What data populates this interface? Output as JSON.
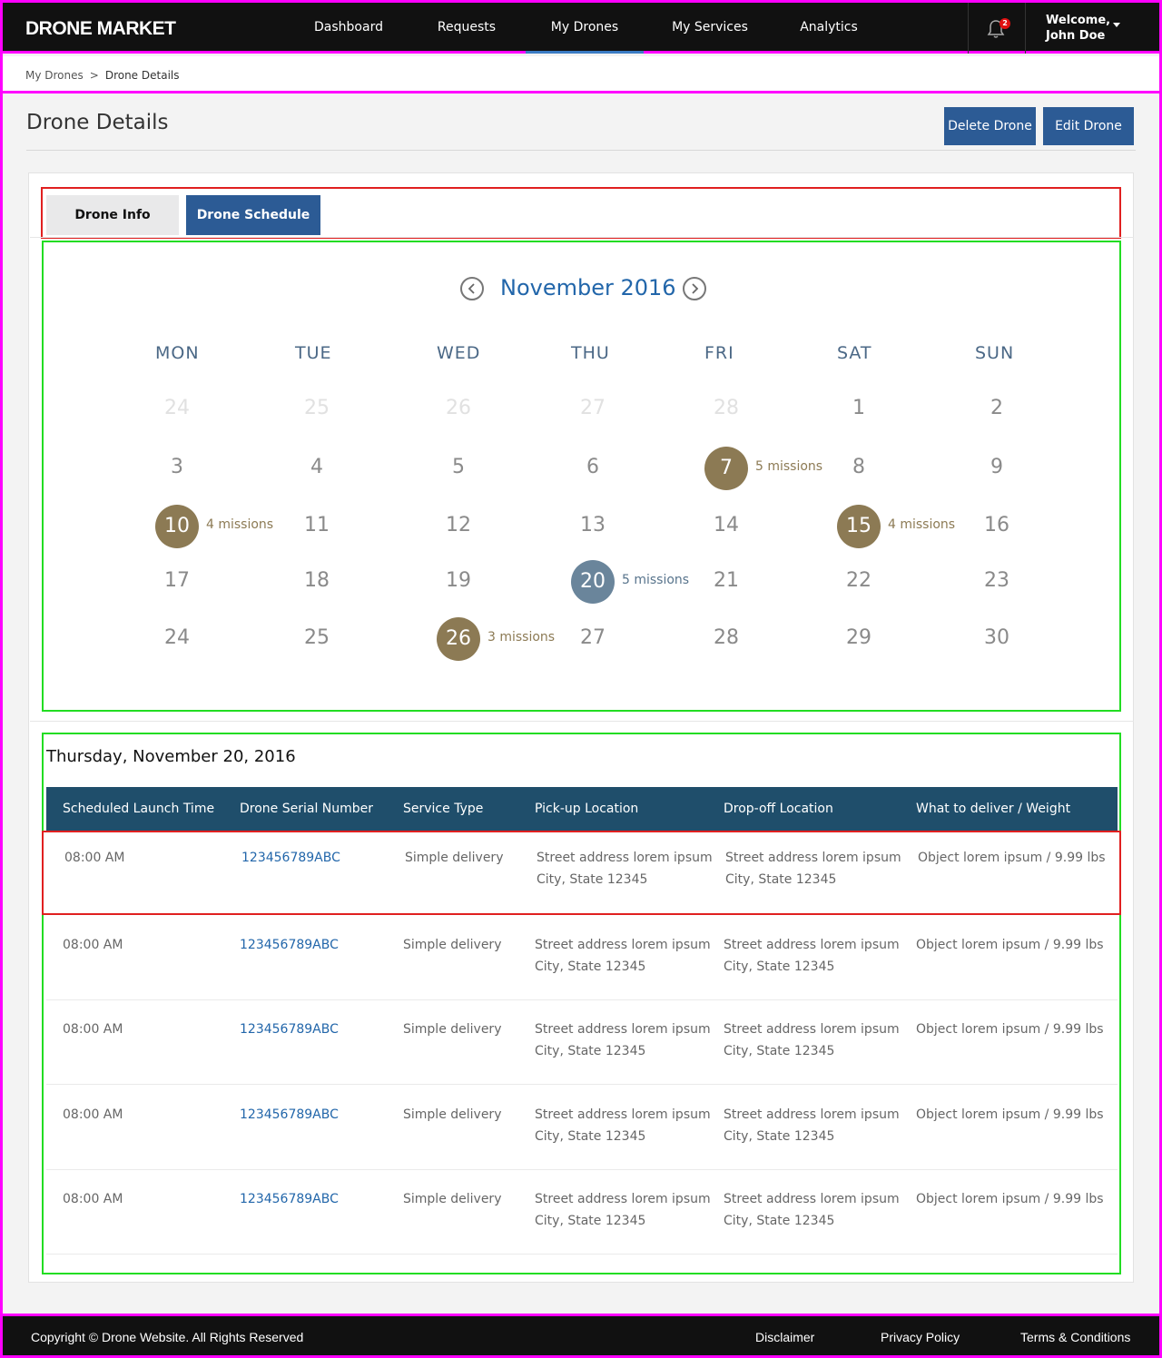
{
  "header": {
    "brand": "DRONE MARKET",
    "nav": [
      {
        "label": "Dashboard",
        "active": false
      },
      {
        "label": "Requests",
        "active": false
      },
      {
        "label": "My Drones",
        "active": true
      },
      {
        "label": "My Services",
        "active": false
      },
      {
        "label": "Analytics",
        "active": false
      }
    ],
    "notification_count": "2",
    "notification_icon": "bell-icon",
    "welcome_line1": "Welcome,",
    "welcome_line2": "John Doe",
    "user_menu_icon": "caret-down-icon"
  },
  "breadcrumb": {
    "items": [
      "My Drones",
      "Drone Details"
    ],
    "separator": ">"
  },
  "page": {
    "title": "Drone Details",
    "delete_label": "Delete Drone",
    "edit_label": "Edit Drone"
  },
  "tabs": [
    {
      "label": "Drone Info",
      "active": false
    },
    {
      "label": "Drone Schedule",
      "active": true
    }
  ],
  "calendar": {
    "month_label": "November 2016",
    "prev_icon": "chevron-left-icon",
    "next_icon": "chevron-right-icon",
    "weekdays": [
      "MON",
      "TUE",
      "WED",
      "THU",
      "FRI",
      "SAT",
      "SUN"
    ],
    "weeks": [
      [
        {
          "d": "24",
          "muted": true
        },
        {
          "d": "25",
          "muted": true
        },
        {
          "d": "26",
          "muted": true
        },
        {
          "d": "27",
          "muted": true
        },
        {
          "d": "28",
          "muted": true
        },
        {
          "d": "1"
        },
        {
          "d": "2"
        }
      ],
      [
        {
          "d": "3"
        },
        {
          "d": "4"
        },
        {
          "d": "5"
        },
        {
          "d": "6"
        },
        {
          "d": "7",
          "missions": "5 missions"
        },
        {
          "d": "8"
        },
        {
          "d": "9"
        }
      ],
      [
        {
          "d": "10",
          "missions": "4 missions"
        },
        {
          "d": "11"
        },
        {
          "d": "12"
        },
        {
          "d": "13"
        },
        {
          "d": "14"
        },
        {
          "d": "15",
          "missions": "4 missions"
        },
        {
          "d": "16"
        }
      ],
      [
        {
          "d": "17"
        },
        {
          "d": "18"
        },
        {
          "d": "19"
        },
        {
          "d": "20",
          "missions": "5 missions",
          "selected": true
        },
        {
          "d": "21"
        },
        {
          "d": "22"
        },
        {
          "d": "23"
        }
      ],
      [
        {
          "d": "24"
        },
        {
          "d": "25"
        },
        {
          "d": "26",
          "missions": "3 missions"
        },
        {
          "d": "27"
        },
        {
          "d": "28"
        },
        {
          "d": "29"
        },
        {
          "d": "30"
        }
      ]
    ],
    "colors": {
      "mission": "#8c7a54",
      "selected": "#6a859b"
    }
  },
  "schedule": {
    "date_label": "Thursday, November 20, 2016",
    "columns": [
      "Scheduled Launch Time",
      "Drone Serial Number",
      "Service Type",
      "Pick-up Location",
      "Drop-off Location",
      "What to deliver / Weight"
    ],
    "rows": [
      {
        "time": "08:00 AM",
        "serial": "123456789ABC",
        "service": "Simple delivery",
        "pickup1": "Street address lorem ipsum",
        "pickup2": "City, State 12345",
        "drop1": "Street address lorem ipsum",
        "drop2": "City, State 12345",
        "deliver": "Object lorem ipsum / 9.99 lbs"
      },
      {
        "time": "08:00 AM",
        "serial": "123456789ABC",
        "service": "Simple delivery",
        "pickup1": "Street address lorem ipsum",
        "pickup2": "City, State 12345",
        "drop1": "Street address lorem ipsum",
        "drop2": "City, State 12345",
        "deliver": "Object lorem ipsum / 9.99 lbs"
      },
      {
        "time": "08:00 AM",
        "serial": "123456789ABC",
        "service": "Simple delivery",
        "pickup1": "Street address lorem ipsum",
        "pickup2": "City, State 12345",
        "drop1": "Street address lorem ipsum",
        "drop2": "City, State 12345",
        "deliver": "Object lorem ipsum / 9.99 lbs"
      },
      {
        "time": "08:00 AM",
        "serial": "123456789ABC",
        "service": "Simple delivery",
        "pickup1": "Street address lorem ipsum",
        "pickup2": "City, State 12345",
        "drop1": "Street address lorem ipsum",
        "drop2": "City, State 12345",
        "deliver": "Object lorem ipsum / 9.99 lbs"
      },
      {
        "time": "08:00 AM",
        "serial": "123456789ABC",
        "service": "Simple delivery",
        "pickup1": "Street address lorem ipsum",
        "pickup2": "City, State 12345",
        "drop1": "Street address lorem ipsum",
        "drop2": "City, State 12345",
        "deliver": "Object lorem ipsum / 9.99 lbs"
      }
    ]
  },
  "footer": {
    "copyright": "Copyright © Drone Website. All Rights Reserved",
    "links": [
      "Disclaimer",
      "Privacy Policy",
      "Terms & Conditions"
    ]
  }
}
